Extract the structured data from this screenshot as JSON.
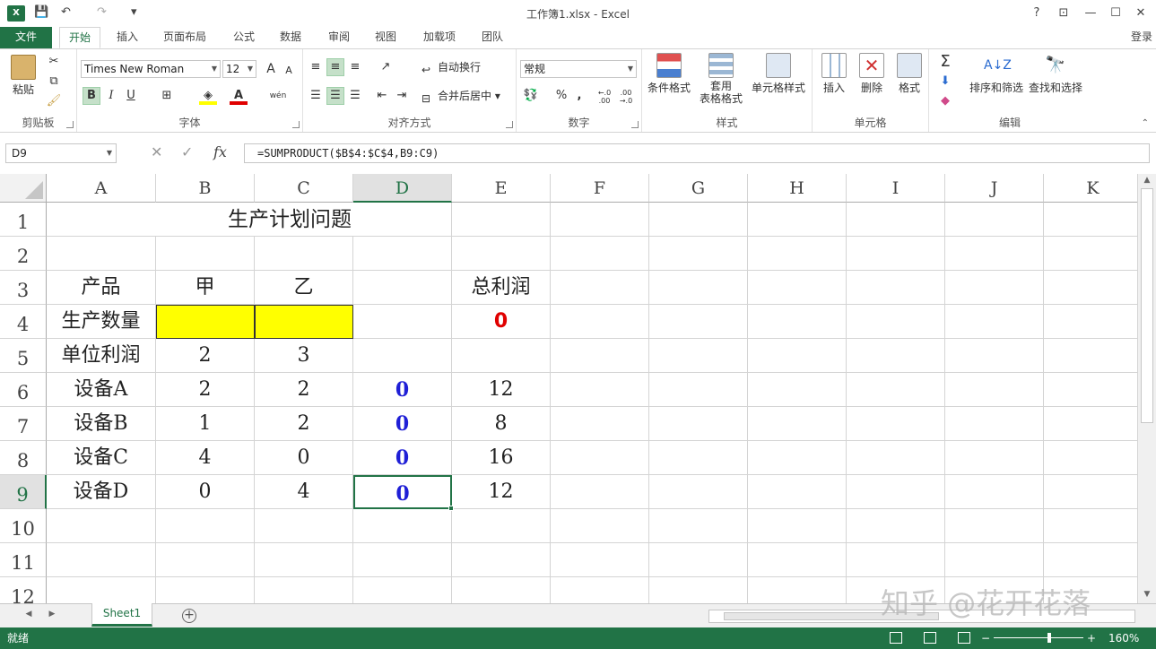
{
  "window": {
    "title": "工作簿1.xlsx - Excel",
    "help": "?",
    "login": "登录"
  },
  "qat": {
    "save": "💾",
    "undo": "↶",
    "redo": "↷",
    "customize": "▾"
  },
  "tabs": [
    "文件",
    "开始",
    "插入",
    "页面布局",
    "公式",
    "数据",
    "审阅",
    "视图",
    "加载项",
    "团队"
  ],
  "ribbon": {
    "clipboard": {
      "label": "剪贴板",
      "paste": "粘贴"
    },
    "font": {
      "label": "字体",
      "name": "Times New Roman",
      "size": "12",
      "bold": "B",
      "italic": "I",
      "underline": "U",
      "grow": "A",
      "shrink": "A",
      "phonetic": "wén"
    },
    "alignment": {
      "label": "对齐方式",
      "wrap": "自动换行",
      "merge": "合并后居中"
    },
    "number": {
      "label": "数字",
      "format": "常规",
      "percent": "%",
      "comma": ",",
      "inc_decimal": "←.0 .00",
      "dec_decimal": ".00 →.0"
    },
    "styles": {
      "label": "样式",
      "conditional": "条件格式",
      "table_format_1": "套用",
      "table_format_2": "表格格式",
      "cell_styles": "单元格样式"
    },
    "cells": {
      "label": "单元格",
      "insert": "插入",
      "delete": "删除",
      "format": "格式"
    },
    "editing": {
      "label": "编辑",
      "sort": "排序和筛选",
      "find": "查找和选择"
    }
  },
  "formula_bar": {
    "name_box": "D9",
    "fx": "fx",
    "formula": "=SUMPRODUCT($B$4:$C$4,B9:C9)"
  },
  "columns": [
    "A",
    "B",
    "C",
    "D",
    "E",
    "F",
    "G",
    "H",
    "I",
    "J",
    "K"
  ],
  "rows": [
    "1",
    "2",
    "3",
    "4",
    "5",
    "6",
    "7",
    "8",
    "9",
    "10",
    "11",
    "12"
  ],
  "cells": {
    "B1": "生产计划问题",
    "A3": "产品",
    "B3": "甲",
    "C3": "乙",
    "E3": "总利润",
    "A4": "生产数量",
    "B4": "",
    "C4": "",
    "E4": "0",
    "A5": "单位利润",
    "B5": "2",
    "C5": "3",
    "A6": "设备A",
    "B6": "2",
    "C6": "2",
    "D6": "0",
    "E6": "12",
    "A7": "设备B",
    "B7": "1",
    "C7": "2",
    "D7": "0",
    "E7": "8",
    "A8": "设备C",
    "B8": "4",
    "C8": "0",
    "D8": "0",
    "E8": "16",
    "A9": "设备D",
    "B9": "0",
    "C9": "4",
    "D9": "0",
    "E9": "12"
  },
  "sheets": [
    "Sheet1"
  ],
  "status": {
    "ready": "就绪",
    "zoom": "160%"
  },
  "watermark": "知乎 @花开花落",
  "colors": {
    "accent": "#217346",
    "input_fill": "#ffff00",
    "profit": "#e00000",
    "usage": "#1f1fd6"
  }
}
